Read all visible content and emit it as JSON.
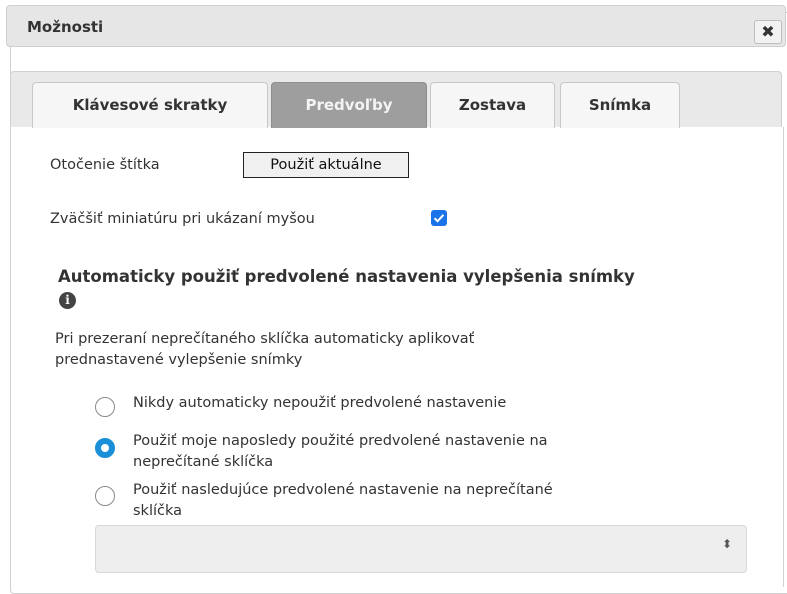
{
  "dialog": {
    "title": "Možnosti",
    "close_label": "✖"
  },
  "tabs": [
    {
      "label": "Klávesové skratky",
      "active": false
    },
    {
      "label": "Predvoľby",
      "active": true
    },
    {
      "label": "Zostava",
      "active": false
    },
    {
      "label": "Snímka",
      "active": false
    }
  ],
  "prefs": {
    "label_rotation_text": "Otočenie štítka",
    "apply_current_label": "Použiť aktuálne",
    "magnify_thumbnail_text": "Zväčšiť miniatúru pri ukázaní myšou",
    "magnify_thumbnail_checked": true,
    "auto_apply_heading": "Automaticky použiť predvolené nastavenia vylepšenia snímky",
    "info_icon_glyph": "i",
    "description_line1": "Pri prezeraní neprečítaného sklíčka automaticky aplikovať",
    "description_line2": "prednastavené vylepšenie snímky",
    "radio_options": [
      {
        "line1": "Nikdy automaticky nepoužiť predvolené nastavenie",
        "line2": "",
        "checked": false
      },
      {
        "line1": "Použiť moje naposledy použité predvolené nastavenie na",
        "line2": "neprečítané sklíčka",
        "checked": true
      },
      {
        "line1": "Použiť nasledujúce predvolené nastavenie na neprečítané",
        "line2": "sklíčka",
        "checked": false
      }
    ],
    "preset_select_value": "",
    "preset_select_arrow": "⬍"
  },
  "colors": {
    "accent_blue": "#1a8fd8",
    "checkbox_blue": "#1a73e8",
    "active_tab_bg": "#9e9e9e"
  }
}
